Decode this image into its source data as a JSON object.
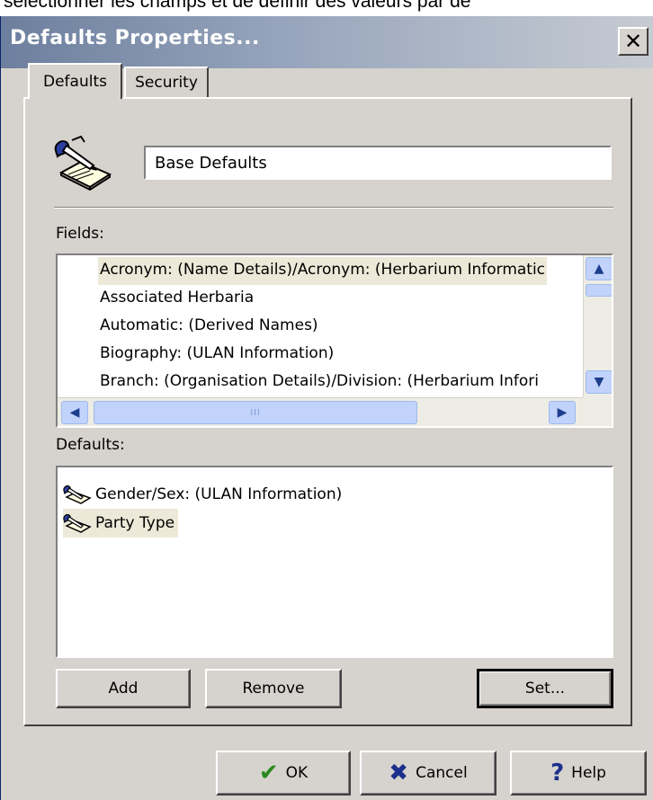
{
  "caption": "sélectionner les champs et de définir des valeurs par dé",
  "window": {
    "title": "Defaults Properties...",
    "close_glyph": "✕"
  },
  "tabs": [
    {
      "label": "Defaults",
      "active": true
    },
    {
      "label": "Security",
      "active": false
    }
  ],
  "profile": {
    "icon": "pen-writing-icon",
    "name_value": "Base Defaults"
  },
  "fields": {
    "label": "Fields:",
    "items": [
      {
        "label": "Acronym: (Name Details)/Acronym: (Herbarium Informatic",
        "selected": true
      },
      {
        "label": "Associated Herbaria",
        "selected": false
      },
      {
        "label": "Automatic: (Derived Names)",
        "selected": false
      },
      {
        "label": "Biography: (ULAN Information)",
        "selected": false
      },
      {
        "label": "Branch: (Organisation Details)/Division: (Herbarium Infori",
        "selected": false
      }
    ],
    "scroll": {
      "up": "▲",
      "down": "▼",
      "left": "◀",
      "right": "▶",
      "grip": "III"
    }
  },
  "defaults": {
    "label": "Defaults:",
    "items": [
      {
        "label": "Gender/Sex: (ULAN Information)",
        "icon": "pen-writing-icon",
        "selected": false
      },
      {
        "label": "Party Type",
        "icon": "pen-writing-icon",
        "selected": true
      }
    ]
  },
  "buttons": {
    "add": "Add",
    "remove": "Remove",
    "set": "Set...",
    "ok": "OK",
    "cancel": "Cancel",
    "help": "Help"
  },
  "colors": {
    "ok_check": "#2a8a1e",
    "cancel_x": "#1c2f8c",
    "help_q": "#1c2f8c"
  }
}
